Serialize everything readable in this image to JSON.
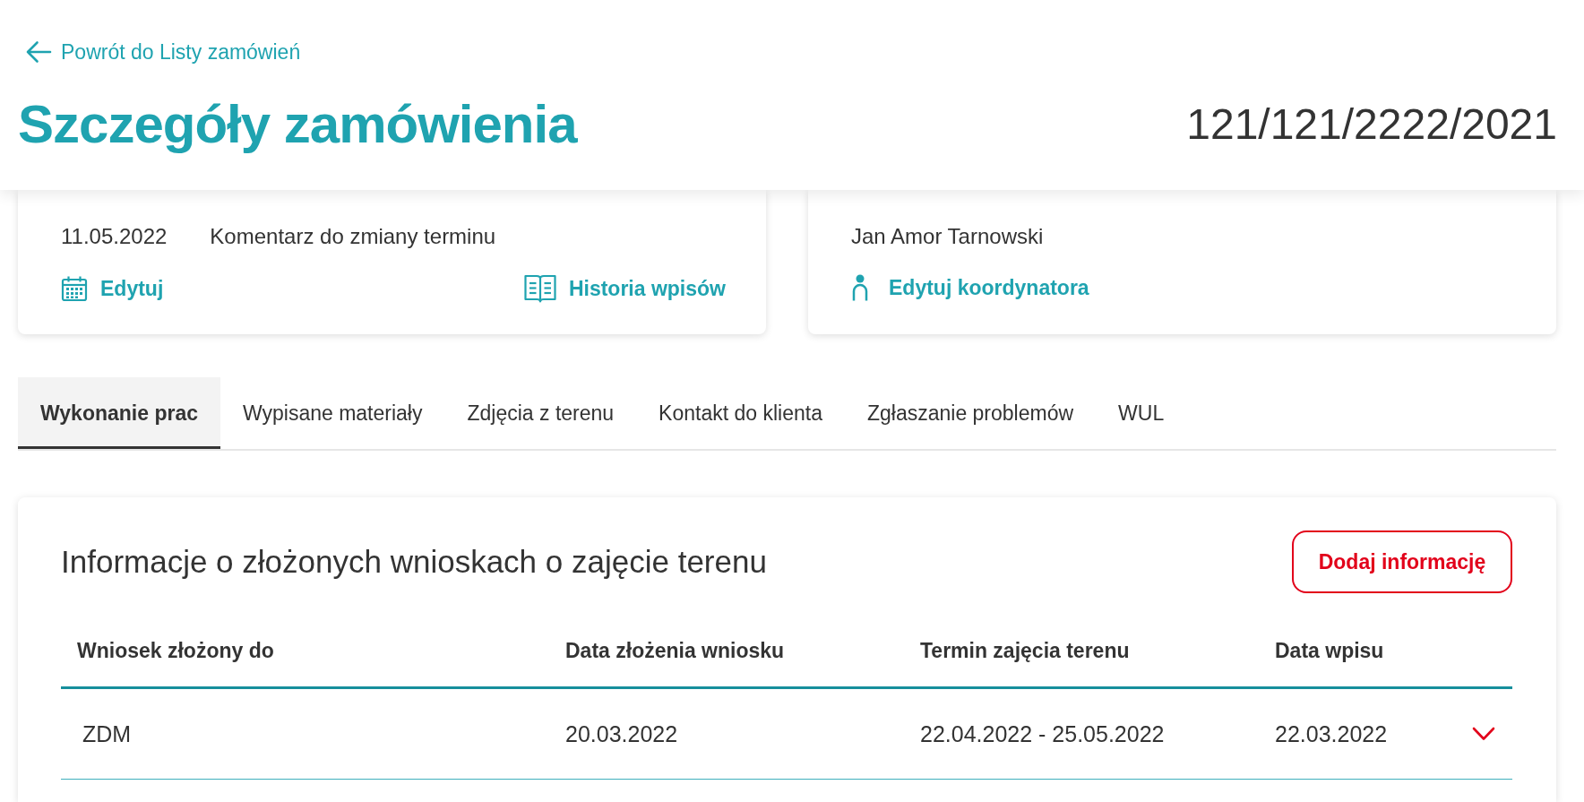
{
  "back_link": {
    "label": "Powrót do Listy zamówień"
  },
  "page_header": {
    "title": "Szczegóły zamówienia",
    "order_number": "121/121/2222/2021"
  },
  "cards": [
    {
      "values": [
        "11.05.2022",
        "Komentarz do zmiany terminu"
      ],
      "actions": [
        {
          "kind": "schedule",
          "label": "Edytuj"
        },
        {
          "kind": "history",
          "label": "Historia wpisów"
        }
      ]
    },
    {
      "values": [
        "Jan Amor Tarnowski"
      ],
      "actions": [
        {
          "kind": "coordinator",
          "label": "Edytuj koordynatora"
        }
      ]
    }
  ],
  "tabs": [
    {
      "label": "Wykonanie prac",
      "selected": true
    },
    {
      "label": "Wypisane materiały",
      "selected": false
    },
    {
      "label": "Zdjęcia z terenu",
      "selected": false
    },
    {
      "label": "Kontakt do klienta",
      "selected": false
    },
    {
      "label": "Zgłaszanie problemów",
      "selected": false
    },
    {
      "label": "WUL",
      "selected": false
    }
  ],
  "panel": {
    "title": "Informacje o złożonych wnioskach o zajęcie terenu",
    "add_button": "Dodaj informację",
    "table": {
      "columns": [
        "Wniosek złożony do",
        "Data złożenia wniosku",
        "Termin zajęcia terenu",
        "Data wpisu"
      ],
      "rows": [
        {
          "cells": [
            "ZDM",
            "20.03.2022",
            "22.04.2022 - 25.05.2022",
            "22.03.2022"
          ],
          "expanded": false
        }
      ]
    }
  }
}
